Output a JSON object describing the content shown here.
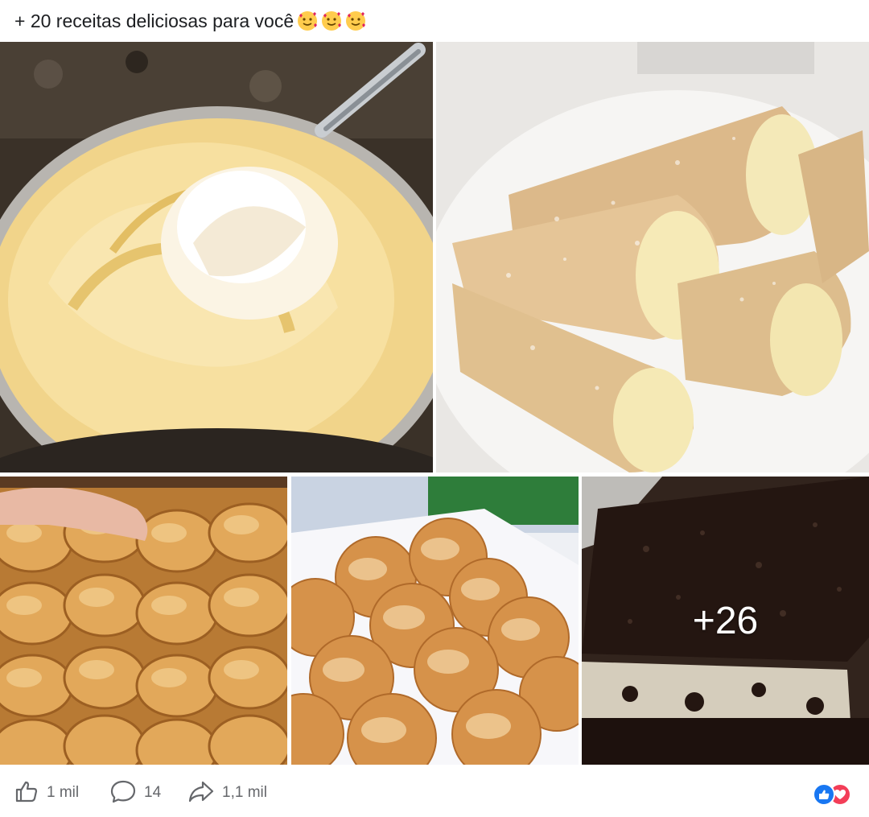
{
  "post": {
    "caption": "+ 20 receitas deliciosas para você",
    "emojis": [
      "smiling-face-with-hearts",
      "smiling-face-with-hearts",
      "smiling-face-with-hearts"
    ]
  },
  "gallery": {
    "photos": [
      {
        "subject": "vanilla-cream-with-whipped-topping"
      },
      {
        "subject": "cream-filled-pastry-horns"
      },
      {
        "subject": "braided-sugar-bread-rolls"
      },
      {
        "subject": "sugar-dusted-donuts-box"
      },
      {
        "subject": "chocolate-cake-bars"
      }
    ],
    "more_count": "+26"
  },
  "actions": {
    "like_count": "1 mil",
    "comment_count": "14",
    "share_count": "1,1 mil"
  },
  "reactions": [
    "like-icon",
    "love-icon"
  ],
  "colors": {
    "muted": "#65676b",
    "like": "#1877f2",
    "love": "#f33e58"
  }
}
